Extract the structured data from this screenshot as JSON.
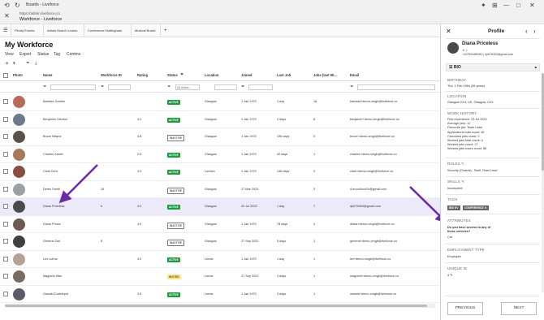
{
  "browser": {
    "tab_title": "Boards - Liveforce",
    "url": "https://admin.liveforce.co",
    "title": "Workforce - Liveforce"
  },
  "tabs": [
    {
      "label": "Plenty Events"
    },
    {
      "label": "Artists Board London"
    },
    {
      "label": "Conference Nottingham"
    },
    {
      "label": "Musical Board"
    },
    {
      "label": "+"
    }
  ],
  "page_title": "My Workforce",
  "menu": [
    "View",
    "Export",
    "Status",
    "Tag",
    "Comms"
  ],
  "columns": [
    "Photo",
    "Name",
    "Workforce ID",
    "Rating",
    "Status",
    "Location",
    "Joined",
    "Last Job",
    "Jobs (last 90...",
    "Email"
  ],
  "status_filter_value": "(4) Active,...",
  "rows": [
    {
      "name": "Barbara Gordon",
      "wid": "",
      "rating": "",
      "status": "ACTIVE",
      "loc": "Glasgow",
      "joined": "1 Jan 1970",
      "last": "1 day",
      "jobs": "18",
      "email": "barbara+demo-vmgb@liveforce.co",
      "color": "#b76b5a"
    },
    {
      "name": "Benjamin Glenton",
      "wid": "",
      "rating": "4.0",
      "status": "ACTIVE",
      "loc": "Glasgow",
      "joined": "1 Jan 1970",
      "last": "3 days",
      "jobs": "8",
      "email": "benjamin+demo-vmgb@liveforce.co",
      "color": "#6b7a8f"
    },
    {
      "name": "Bruce Wayne",
      "wid": "",
      "rating": "4.8",
      "status": "INACTIVE",
      "loc": "Glasgow",
      "joined": "1 Jan 1970",
      "last": "136 days",
      "jobs": "0",
      "email": "bruce+demo-vmgb@liveforce.co",
      "color": "#5b5148"
    },
    {
      "name": "Charles Xavier",
      "wid": "",
      "rating": "2.5",
      "status": "ACTIVE",
      "loc": "Glasgow",
      "joined": "1 Jan 1970",
      "last": "40 days",
      "jobs": "1",
      "email": "charles+demo-vmgb@liveforce.co",
      "color": "#a8785a"
    },
    {
      "name": "Clark Kent",
      "wid": "",
      "rating": "4.9",
      "status": "ACTIVE",
      "loc": "London",
      "joined": "1 Jan 1970",
      "last": "146 days",
      "jobs": "0",
      "email": "clark+demo-vmgb@liveforce.co",
      "color": "#8c4b3f"
    },
    {
      "name": "Derek Smith",
      "wid": "15",
      "rating": "",
      "status": "INACTIVE",
      "loc": "Glasgow",
      "joined": "27 Mar 2023",
      "last": "",
      "jobs": "0",
      "email": "d.mcculloch24@gmail.com",
      "color": "#9aa0a8"
    },
    {
      "name": "Diana Priceless",
      "wid": "6",
      "rating": "4.0",
      "status": "ACTIVE",
      "loc": "Glasgow",
      "joined": "22 Jul 2022",
      "last": "1 day",
      "jobs": "7",
      "email": "dp676353@gmail.com",
      "color": "#4a4a4a"
    },
    {
      "name": "Diana Prince",
      "wid": "",
      "rating": "4.5",
      "status": "INACTIVE",
      "loc": "Glasgow",
      "joined": "1 Jan 1970",
      "last": "78 days",
      "jobs": "0",
      "email": "diana+demo-vmgb@liveforce.co",
      "color": "#6d5a52"
    },
    {
      "name": "General Zod",
      "wid": "8",
      "rating": "",
      "status": "INACTIVE",
      "loc": "Glasgow",
      "joined": "27 Sep 2022",
      "last": "5 days",
      "jobs": "1",
      "email": "general+demo-vmgb@liveforce.co",
      "color": "#3f3f3f"
    },
    {
      "name": "Lex Luthor",
      "wid": "",
      "rating": "3.0",
      "status": "ACTIVE",
      "loc": "Leeds",
      "joined": "1 Jan 1970",
      "last": "1 day",
      "jobs": "1",
      "email": "lex+demo-vmgb@liveforce.co",
      "color": "#b5a398"
    },
    {
      "name": "Magneto Man",
      "wid": "",
      "rating": "",
      "status": "INVITED",
      "loc": "Leeds",
      "joined": "27 Sep 2022",
      "last": "3 days",
      "jobs": "1",
      "email": "magneto+demo-vmgb@liveforce.co",
      "color": "#7b6a60"
    },
    {
      "name": "Oswald Cobblepot",
      "wid": "",
      "rating": "3.5",
      "status": "ACTIVE",
      "loc": "Leeds",
      "joined": "1 Jan 1970",
      "last": "3 days",
      "jobs": "1",
      "email": "oswald+demo-vmgb@liveforce.co",
      "color": "#5a5a6a"
    }
  ],
  "panel": {
    "title": "Profile",
    "name": "Diana Priceless",
    "rating": "4",
    "contact": "+447834485343 | dp676353@gmail.com",
    "section": "BIO",
    "birthday_label": "BIRTHDAY",
    "birthday": "Thu, 2 Feb 1984 (39 years)",
    "location_label": "LOCATION",
    "location": "Glasgow G13, UK, Glasgow, G13",
    "history_label": "WORK HISTORY",
    "history": [
      "First experience: 23 Jul 2022",
      "Average jobs: 11",
      "Favourite job: Team Lead",
      "Applications total count: 45",
      "Cancelled jobs count: 0",
      "Worked jobs total count: 0",
      "Worked jobs count: 27",
      "Worked jobs hours count: 86"
    ],
    "roles_label": "ROLES",
    "roles": "Security (Guards) , Staff, Team Lead",
    "skills_label": "SKILLS",
    "skills": "Incomplete",
    "tags_label": "TAGS",
    "tags": [
      "BIG EV",
      "CONFERENCE ✕"
    ],
    "attributes_label": "ATTRIBUTES",
    "attr_q": "Do you have access to any of these vehicles?",
    "attr_a": "Car",
    "employment_label": "EMPLOYMENT TYPE",
    "employment": "Employee",
    "uid_label": "UNIQUE ID",
    "uid": "4",
    "prev": "PREVIOUS",
    "next": "NEXT"
  }
}
